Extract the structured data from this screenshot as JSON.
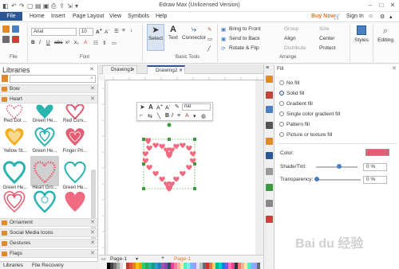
{
  "window": {
    "title": "Edraw Max (Unlicensed Version)",
    "controls": [
      "–",
      "□",
      "✕"
    ]
  },
  "menu": {
    "file": "File",
    "items": [
      "Home",
      "Insert",
      "Page Layout",
      "View",
      "Symbols",
      "Help"
    ],
    "buy_now": "Buy Now",
    "sign_in": "Sign In"
  },
  "ribbon": {
    "groups": {
      "file": "File",
      "font": "Font",
      "basic_tools": "Basic Tools",
      "arrange": "Arrange"
    },
    "font_name": "Arial",
    "font_size": "10",
    "tools": {
      "select": "Select",
      "text": "Text",
      "connector": "Connector"
    },
    "arrange": {
      "bring_to_front": "Bring to Front",
      "send_to_back": "Send to Back",
      "rotate_flip": "Rotate & Flip",
      "group": "Group",
      "align": "Align",
      "distribute": "Distribute",
      "size": "Size",
      "center": "Center",
      "protect": "Protect"
    },
    "styles": "Styles",
    "editing": "Editing"
  },
  "libraries": {
    "title": "Libraries",
    "sections_top": [
      "Bow",
      "Heart"
    ],
    "shape_labels": [
      [
        "Red Dot ...",
        "Green He...",
        "Red Curv..."
      ],
      [
        "Yellow St...",
        "Green He...",
        "Finger Pri..."
      ],
      [
        "Green He...",
        "Heart Gro...",
        "Green He..."
      ]
    ],
    "sections_bottom": [
      "Ornament",
      "Social Media Icons",
      "Gestures",
      "Flags"
    ],
    "tabs": [
      "Libraries",
      "File Recovery"
    ]
  },
  "documents": {
    "tabs": [
      "Drawing1",
      "Drawing2"
    ],
    "active_tab": "Drawing2",
    "pages": [
      "Page-1",
      "Page-1"
    ]
  },
  "minitoolbar": {
    "font": "rial"
  },
  "fill": {
    "title": "Fill",
    "options": [
      "No fill",
      "Solid fill",
      "Gradient fill",
      "Single color gradient fill",
      "Pattern fill",
      "Picture or texture fill"
    ],
    "selected_index": 1,
    "color_label": "Color:",
    "color_value": "#e45c72",
    "shade_label": "Shade/Tint:",
    "shade_value": "0 %",
    "transparency_label": "Transparency:",
    "transparency_value": "0 %"
  },
  "watermark": "Bai du 经验",
  "colors": {
    "accent": "#2b5797",
    "heart_pink": "#f16b80",
    "heart_teal": "#2bb3b0",
    "select_green": "#3c9a3c"
  }
}
